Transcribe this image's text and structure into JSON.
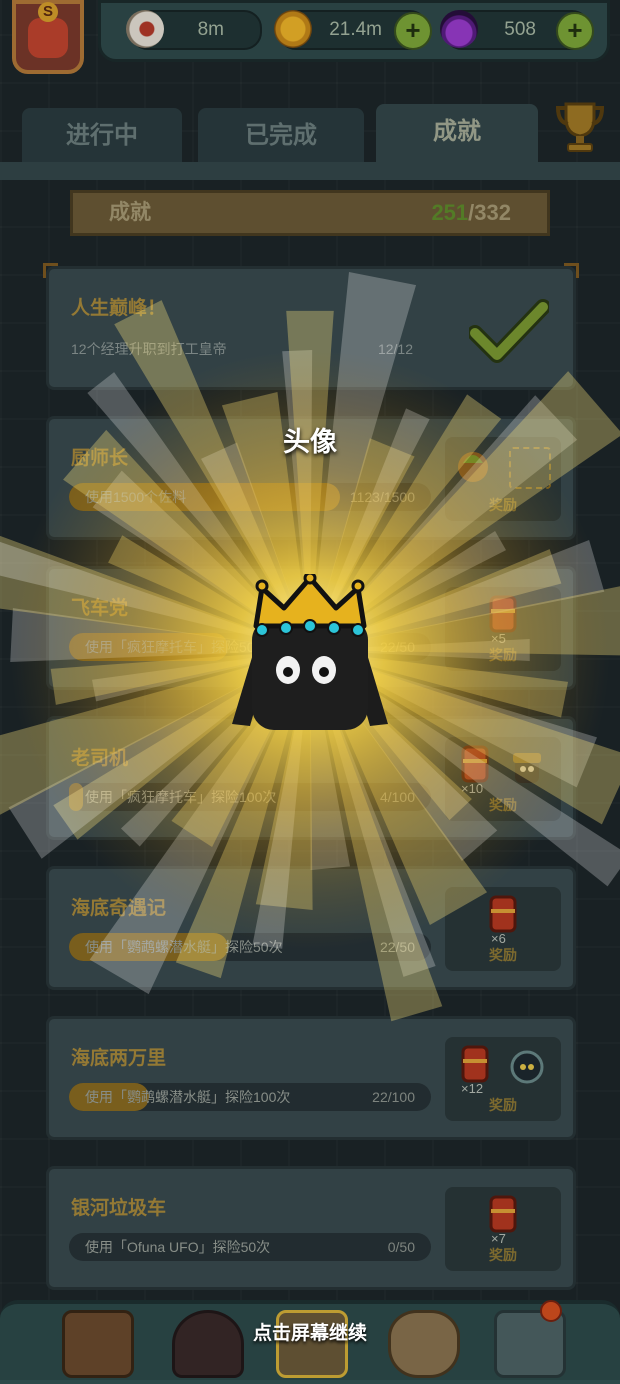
{
  "header": {
    "resources": [
      {
        "name": "eyeball",
        "icon": "eyeball-icon",
        "value": "8m"
      },
      {
        "name": "coin",
        "icon": "coin-icon",
        "value": "21.4m"
      },
      {
        "name": "potion",
        "icon": "potion-icon",
        "value": "508"
      }
    ],
    "plus_label": "+"
  },
  "tabs": [
    {
      "label": "进行中",
      "active": false
    },
    {
      "label": "已完成",
      "active": false
    },
    {
      "label": "成就",
      "active": true
    }
  ],
  "summary": {
    "label": "成就",
    "done": "251",
    "separator": "/",
    "total": "332"
  },
  "achievements": [
    {
      "title": "人生巅峰！",
      "desc": "12个经理升职到打工皇帝",
      "progress": "12/12",
      "fraction": 1,
      "completed": true
    },
    {
      "title": "厨师长",
      "desc": "使用1500个佐料",
      "progress": "1123/1500",
      "fraction": 0.749,
      "reward_label": "奖励"
    },
    {
      "title": "飞车党",
      "desc": "使用「疯狂摩托车」探险50次",
      "progress": "22/50",
      "fraction": 0.44,
      "reward_label": "奖励",
      "reward_mult": "×5"
    },
    {
      "title": "老司机",
      "desc": "使用「疯狂摩托车」探险100次",
      "progress": "4/100",
      "fraction": 0.04,
      "reward_label": "奖励",
      "reward_mult": "×10"
    },
    {
      "title": "海底奇遇记",
      "desc": "使用「鹦鹉螺潜水艇」探险50次",
      "progress": "22/50",
      "fraction": 0.44,
      "reward_label": "奖励",
      "reward_mult": "×6"
    },
    {
      "title": "海底两万里",
      "desc": "使用「鹦鹉螺潜水艇」探险100次",
      "progress": "22/100",
      "fraction": 0.22,
      "reward_label": "奖励",
      "reward_mult": "×12"
    },
    {
      "title": "银河垃圾车",
      "desc": "使用「Ofuna UFO」探险50次",
      "progress": "0/50",
      "fraction": 0,
      "reward_label": "奖励",
      "reward_mult": "×7"
    }
  ],
  "overlay": {
    "reveal_title": "头像",
    "continue_text": "点击屏幕继续"
  },
  "bottom_nav": [
    {
      "icon": "shop-building-icon"
    },
    {
      "icon": "monster-icon"
    },
    {
      "icon": "book-icon"
    },
    {
      "icon": "money-bag-icon"
    },
    {
      "icon": "grid-menu-icon"
    }
  ],
  "colors": {
    "accent_gold": "#f5d040",
    "progress_green": "#5f8c2c",
    "panel": "#3a4b4f"
  }
}
